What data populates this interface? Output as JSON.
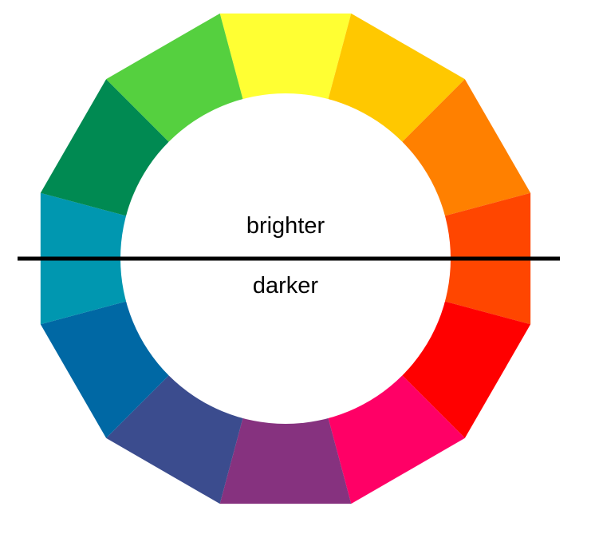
{
  "labels": {
    "top": "brighter",
    "bottom": "darker"
  },
  "color_wheel": {
    "segments": [
      {
        "name": "yellow",
        "color": "#FFFF33"
      },
      {
        "name": "yellow-orange",
        "color": "#FFC800"
      },
      {
        "name": "orange",
        "color": "#FF8000"
      },
      {
        "name": "red-orange",
        "color": "#FF4600"
      },
      {
        "name": "red",
        "color": "#FF0000"
      },
      {
        "name": "red-magenta",
        "color": "#FF0066"
      },
      {
        "name": "purple",
        "color": "#86327F"
      },
      {
        "name": "blue-violet",
        "color": "#3B4C8E"
      },
      {
        "name": "blue",
        "color": "#0068A4"
      },
      {
        "name": "cyan",
        "color": "#0097B0"
      },
      {
        "name": "green",
        "color": "#008A52"
      },
      {
        "name": "yellow-green",
        "color": "#55D03F"
      }
    ]
  },
  "divider": {
    "color": "#000000"
  }
}
